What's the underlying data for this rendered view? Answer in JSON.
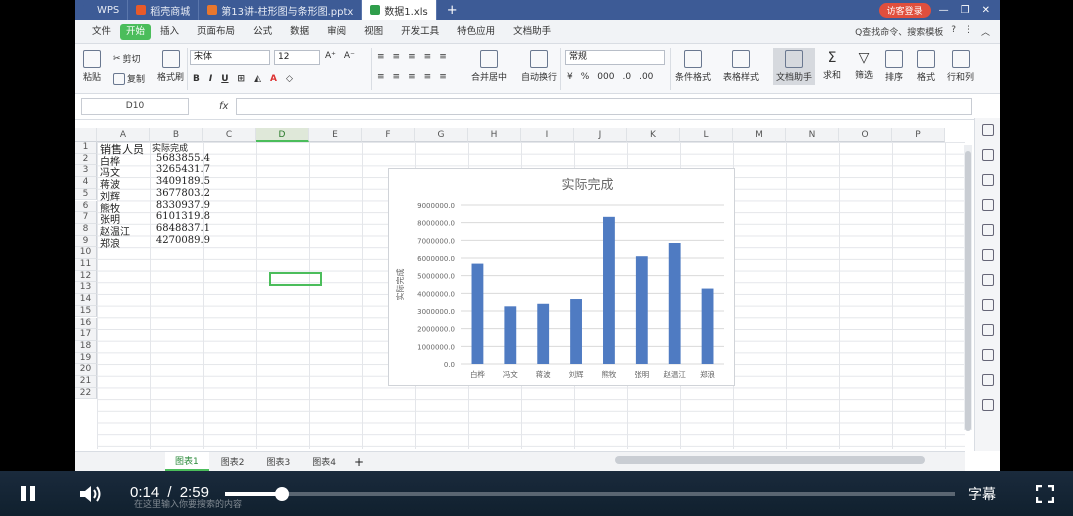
{
  "tabs": [
    {
      "label": "WPS",
      "color": "#3d5b96"
    },
    {
      "label": "稻壳商城",
      "color": "#e85a2a"
    },
    {
      "label": "第13讲-柱形图与条形图.pptx",
      "color": "#e8772e"
    },
    {
      "label": "数据1.xls",
      "color": "#2f9e4b"
    }
  ],
  "login_label": "访客登录",
  "menus": [
    "文件",
    "开始",
    "插入",
    "页面布局",
    "公式",
    "数据",
    "审阅",
    "视图",
    "开发工具",
    "特色应用",
    "文档助手"
  ],
  "menu_search": "Q查找命令、搜索模板",
  "ribbon": {
    "paste": "粘贴",
    "cut": "剪切",
    "copy": "复制",
    "format_painter": "格式刷",
    "font_name": "宋体",
    "font_size": "12",
    "merge_center": "合并居中",
    "wrap_text": "自动换行",
    "number_format": "常规",
    "cond_format": "条件格式",
    "table_style": "表格样式",
    "doc_assist": "文档助手",
    "sum": "求和",
    "filter": "筛选",
    "sort": "排序",
    "format": "格式",
    "row_col": "行和列"
  },
  "name_box": "D10",
  "fx_label": "fx",
  "columns": [
    "A",
    "B",
    "C",
    "D",
    "E",
    "F",
    "G",
    "H",
    "I",
    "J",
    "K",
    "L",
    "M",
    "N",
    "O",
    "P"
  ],
  "rows": [
    "1",
    "2",
    "3",
    "4",
    "5",
    "6",
    "7",
    "8",
    "9",
    "10",
    "11",
    "12",
    "13",
    "14",
    "15",
    "16",
    "17",
    "18",
    "19",
    "20",
    "21",
    "22"
  ],
  "table": {
    "header": [
      "销售人员",
      "实际完成"
    ],
    "rows": [
      [
        "白桦",
        "5683855.4"
      ],
      [
        "冯文",
        "3265431.7"
      ],
      [
        "蒋波",
        "3409189.5"
      ],
      [
        "刘辉",
        "3677803.2"
      ],
      [
        "熊牧",
        "8330937.9"
      ],
      [
        "张明",
        "6101319.8"
      ],
      [
        "赵温江",
        "6848837.1"
      ],
      [
        "郑浪",
        "4270089.9"
      ]
    ]
  },
  "chart_data": {
    "type": "bar",
    "title": "实际完成",
    "ylabel": "实际完成",
    "categories": [
      "白桦",
      "冯文",
      "蒋波",
      "刘辉",
      "熊牧",
      "张明",
      "赵温江",
      "郑浪"
    ],
    "values": [
      5683855.4,
      3265431.7,
      3409189.5,
      3677803.2,
      8330937.9,
      6101319.8,
      6848837.1,
      4270089.9
    ],
    "ylim": [
      0,
      9000000
    ],
    "yticks": [
      "0.0",
      "1000000.0",
      "2000000.0",
      "3000000.0",
      "4000000.0",
      "5000000.0",
      "6000000.0",
      "7000000.0",
      "8000000.0",
      "9000000.0"
    ],
    "grid": true,
    "bar_color": "#4f7bc2"
  },
  "sheets": [
    "图表1",
    "图表2",
    "图表3",
    "图表4"
  ],
  "player": {
    "current": "0:14",
    "separator": "/",
    "duration": "2:59",
    "progress": 0.078,
    "subtitles": "字幕"
  },
  "taskbar_search": "在这里输入你要搜索的内容"
}
